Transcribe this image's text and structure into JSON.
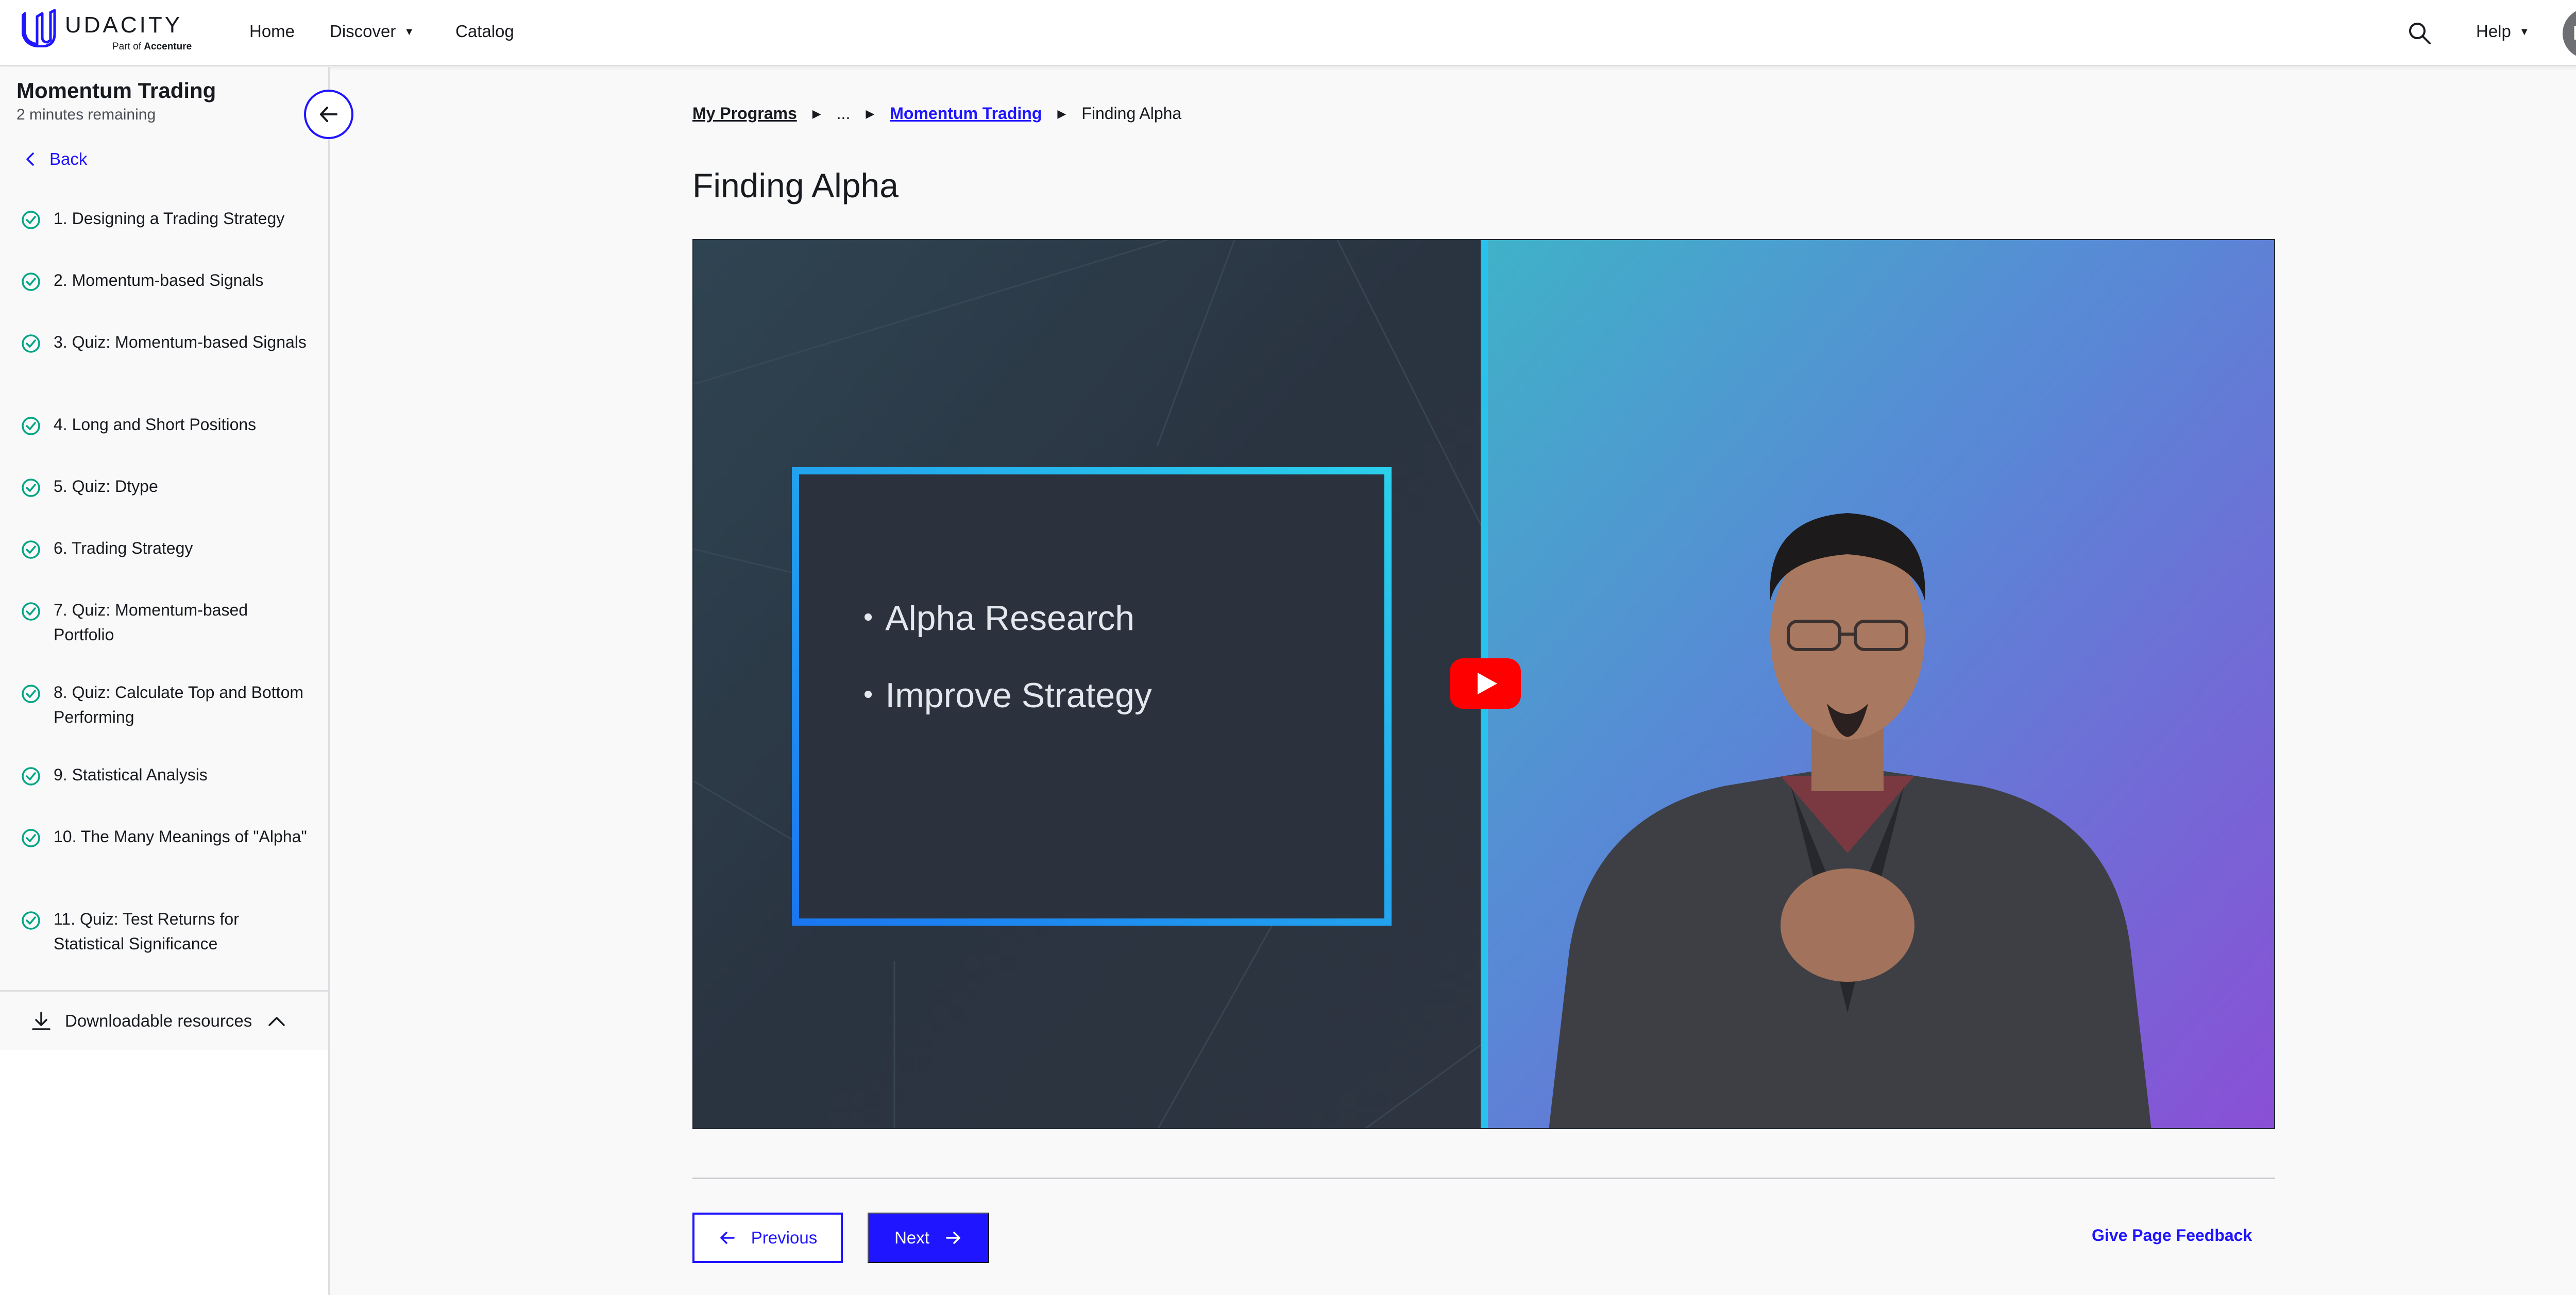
{
  "header": {
    "brand": "UDACITY",
    "brand_subtitle_prefix": "Part of",
    "brand_subtitle_company": "Accenture",
    "nav": [
      {
        "label": "Home"
      },
      {
        "label": "Discover"
      },
      {
        "label": "Catalog"
      }
    ],
    "help_label": "Help",
    "avatar_initials": "HC"
  },
  "sidebar": {
    "course_title": "Momentum Trading",
    "time_remaining": "2 minutes remaining",
    "back_label": "Back",
    "lessons": [
      {
        "label": "1. Designing a Trading Strategy",
        "completed": true
      },
      {
        "label": "2. Momentum-based Signals",
        "completed": true
      },
      {
        "label": "3. Quiz: Momentum-based Signals",
        "completed": true
      },
      {
        "label": "4. Long and Short Positions",
        "completed": true
      },
      {
        "label": "5. Quiz: Dtype",
        "completed": true
      },
      {
        "label": "6. Trading Strategy",
        "completed": true
      },
      {
        "label": "7. Quiz: Momentum-based Portfolio",
        "completed": true
      },
      {
        "label": "8. Quiz: Calculate Top and Bottom Performing",
        "completed": true
      },
      {
        "label": "9. Statistical Analysis",
        "completed": true
      },
      {
        "label": "10. The Many Meanings of \"Alpha\"",
        "completed": true
      },
      {
        "label": "11. Quiz: Test Returns for Statistical Significance",
        "completed": true
      }
    ],
    "downloads_label": "Downloadable resources"
  },
  "breadcrumb": {
    "root": "My Programs",
    "ellipsis": "...",
    "parent": "Momentum Trading",
    "current": "Finding Alpha"
  },
  "main": {
    "title": "Finding Alpha",
    "video": {
      "slide_bullets": [
        "Alpha Research",
        "Improve Strategy"
      ]
    },
    "previous_label": "Previous",
    "next_label": "Next",
    "feedback_label": "Give Page Feedback"
  },
  "colors": {
    "accent": "#2015ff",
    "check": "#02a586",
    "avatar_bg": "#6d6f73",
    "youtube_red": "#ff0000"
  }
}
